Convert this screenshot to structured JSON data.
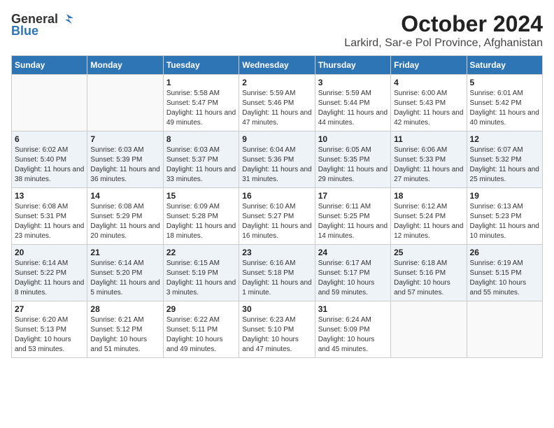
{
  "logo": {
    "general": "General",
    "blue": "Blue"
  },
  "title": "October 2024",
  "location": "Larkird, Sar-e Pol Province, Afghanistan",
  "days_of_week": [
    "Sunday",
    "Monday",
    "Tuesday",
    "Wednesday",
    "Thursday",
    "Friday",
    "Saturday"
  ],
  "weeks": [
    [
      {
        "day": "",
        "info": ""
      },
      {
        "day": "",
        "info": ""
      },
      {
        "day": "1",
        "info": "Sunrise: 5:58 AM\nSunset: 5:47 PM\nDaylight: 11 hours and 49 minutes."
      },
      {
        "day": "2",
        "info": "Sunrise: 5:59 AM\nSunset: 5:46 PM\nDaylight: 11 hours and 47 minutes."
      },
      {
        "day": "3",
        "info": "Sunrise: 5:59 AM\nSunset: 5:44 PM\nDaylight: 11 hours and 44 minutes."
      },
      {
        "day": "4",
        "info": "Sunrise: 6:00 AM\nSunset: 5:43 PM\nDaylight: 11 hours and 42 minutes."
      },
      {
        "day": "5",
        "info": "Sunrise: 6:01 AM\nSunset: 5:42 PM\nDaylight: 11 hours and 40 minutes."
      }
    ],
    [
      {
        "day": "6",
        "info": "Sunrise: 6:02 AM\nSunset: 5:40 PM\nDaylight: 11 hours and 38 minutes."
      },
      {
        "day": "7",
        "info": "Sunrise: 6:03 AM\nSunset: 5:39 PM\nDaylight: 11 hours and 36 minutes."
      },
      {
        "day": "8",
        "info": "Sunrise: 6:03 AM\nSunset: 5:37 PM\nDaylight: 11 hours and 33 minutes."
      },
      {
        "day": "9",
        "info": "Sunrise: 6:04 AM\nSunset: 5:36 PM\nDaylight: 11 hours and 31 minutes."
      },
      {
        "day": "10",
        "info": "Sunrise: 6:05 AM\nSunset: 5:35 PM\nDaylight: 11 hours and 29 minutes."
      },
      {
        "day": "11",
        "info": "Sunrise: 6:06 AM\nSunset: 5:33 PM\nDaylight: 11 hours and 27 minutes."
      },
      {
        "day": "12",
        "info": "Sunrise: 6:07 AM\nSunset: 5:32 PM\nDaylight: 11 hours and 25 minutes."
      }
    ],
    [
      {
        "day": "13",
        "info": "Sunrise: 6:08 AM\nSunset: 5:31 PM\nDaylight: 11 hours and 23 minutes."
      },
      {
        "day": "14",
        "info": "Sunrise: 6:08 AM\nSunset: 5:29 PM\nDaylight: 11 hours and 20 minutes."
      },
      {
        "day": "15",
        "info": "Sunrise: 6:09 AM\nSunset: 5:28 PM\nDaylight: 11 hours and 18 minutes."
      },
      {
        "day": "16",
        "info": "Sunrise: 6:10 AM\nSunset: 5:27 PM\nDaylight: 11 hours and 16 minutes."
      },
      {
        "day": "17",
        "info": "Sunrise: 6:11 AM\nSunset: 5:25 PM\nDaylight: 11 hours and 14 minutes."
      },
      {
        "day": "18",
        "info": "Sunrise: 6:12 AM\nSunset: 5:24 PM\nDaylight: 11 hours and 12 minutes."
      },
      {
        "day": "19",
        "info": "Sunrise: 6:13 AM\nSunset: 5:23 PM\nDaylight: 11 hours and 10 minutes."
      }
    ],
    [
      {
        "day": "20",
        "info": "Sunrise: 6:14 AM\nSunset: 5:22 PM\nDaylight: 11 hours and 8 minutes."
      },
      {
        "day": "21",
        "info": "Sunrise: 6:14 AM\nSunset: 5:20 PM\nDaylight: 11 hours and 5 minutes."
      },
      {
        "day": "22",
        "info": "Sunrise: 6:15 AM\nSunset: 5:19 PM\nDaylight: 11 hours and 3 minutes."
      },
      {
        "day": "23",
        "info": "Sunrise: 6:16 AM\nSunset: 5:18 PM\nDaylight: 11 hours and 1 minute."
      },
      {
        "day": "24",
        "info": "Sunrise: 6:17 AM\nSunset: 5:17 PM\nDaylight: 10 hours and 59 minutes."
      },
      {
        "day": "25",
        "info": "Sunrise: 6:18 AM\nSunset: 5:16 PM\nDaylight: 10 hours and 57 minutes."
      },
      {
        "day": "26",
        "info": "Sunrise: 6:19 AM\nSunset: 5:15 PM\nDaylight: 10 hours and 55 minutes."
      }
    ],
    [
      {
        "day": "27",
        "info": "Sunrise: 6:20 AM\nSunset: 5:13 PM\nDaylight: 10 hours and 53 minutes."
      },
      {
        "day": "28",
        "info": "Sunrise: 6:21 AM\nSunset: 5:12 PM\nDaylight: 10 hours and 51 minutes."
      },
      {
        "day": "29",
        "info": "Sunrise: 6:22 AM\nSunset: 5:11 PM\nDaylight: 10 hours and 49 minutes."
      },
      {
        "day": "30",
        "info": "Sunrise: 6:23 AM\nSunset: 5:10 PM\nDaylight: 10 hours and 47 minutes."
      },
      {
        "day": "31",
        "info": "Sunrise: 6:24 AM\nSunset: 5:09 PM\nDaylight: 10 hours and 45 minutes."
      },
      {
        "day": "",
        "info": ""
      },
      {
        "day": "",
        "info": ""
      }
    ]
  ]
}
